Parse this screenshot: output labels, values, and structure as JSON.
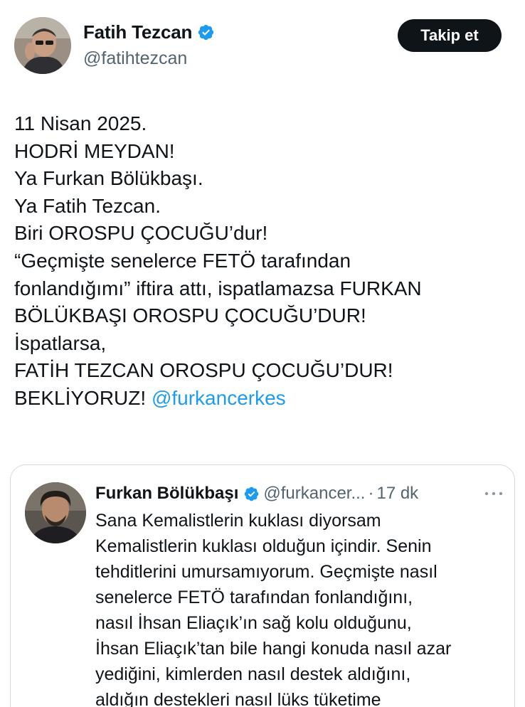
{
  "post": {
    "author": {
      "name": "Fatih Tezcan",
      "handle": "@fatihtezcan",
      "verified": true,
      "avatar_icon": "profile-photo"
    },
    "follow_label": "Takip et",
    "body_lines": [
      "11 Nisan 2025.",
      "HODRİ MEYDAN!",
      "Ya Furkan Bölükbaşı.",
      "Ya Fatih Tezcan.",
      "Biri OROSPU ÇOCUĞU’dur!",
      "“Geçmişte senelerce FETÖ tarafından",
      "fonlandığımı” iftira attı, ispatlamazsa  FURKAN",
      "BÖLÜKBAŞI OROSPU ÇOCUĞU’DUR!",
      "İspatlarsa,",
      "FATİH TEZCAN OROSPU ÇOCUĞU’DUR!"
    ],
    "last_line_text": "BEKLİYORUZ!",
    "mention": "@furkancerkes"
  },
  "quoted": {
    "author": {
      "name": "Furkan Bölükbaşı",
      "handle": "@furkancer...",
      "verified": true,
      "avatar_icon": "profile-photo"
    },
    "separator": "·",
    "time": "17 dk",
    "more_icon": "more-horizontal-icon",
    "body_lines": [
      "Sana Kemalistlerin kuklası diyorsam",
      "Kemalistlerin kuklası olduğun içindir. Senin",
      "tehditlerini umursamıyorum. Geçmişte nasıl",
      "senelerce FETÖ tarafından fonlandığını,",
      "nasıl İhsan Eliaçık’ın sağ kolu olduğunu,",
      "İhsan Eliaçık’tan bile hangi konuda nasıl azar",
      "yediğini, kimlerden nasıl destek aldığını,",
      "aldığın destekleri nasıl lüks tüketime"
    ]
  },
  "colors": {
    "text": "#0f1419",
    "secondary": "#536471",
    "link": "#1d9bf0",
    "verified": "#1d9bf0",
    "follow_bg": "#0f1419",
    "border": "#cfd9de"
  }
}
